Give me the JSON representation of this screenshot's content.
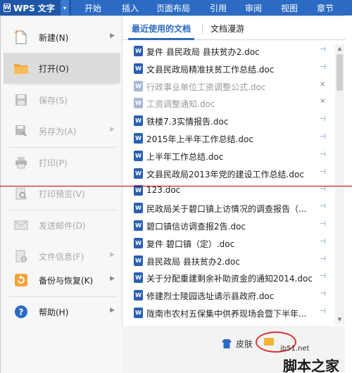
{
  "topbar": {
    "app_button": "WPS 文字",
    "tabs": [
      "开始",
      "插入",
      "页面布局",
      "引用",
      "审阅",
      "视图",
      "章节"
    ]
  },
  "menu": {
    "items": [
      {
        "label": "新建(N)",
        "icon": "new-document-icon",
        "enabled": true,
        "submenu": true
      },
      {
        "label": "打开(O)",
        "icon": "open-folder-icon",
        "enabled": true,
        "submenu": false,
        "selected": true
      },
      {
        "label": "保存(S)",
        "icon": "save-icon",
        "enabled": false,
        "submenu": false
      },
      {
        "label": "另存为(A)",
        "icon": "save-as-icon",
        "enabled": false,
        "submenu": true
      },
      {
        "label": "打印(P)",
        "icon": "printer-icon",
        "enabled": false,
        "submenu": false
      },
      {
        "label": "打印预览(V)",
        "icon": "print-preview-icon",
        "enabled": false,
        "submenu": false
      },
      {
        "label": "发送邮件(D)",
        "icon": "mail-icon",
        "enabled": false,
        "submenu": false
      },
      {
        "label": "文件信息(F)",
        "icon": "info-icon",
        "enabled": false,
        "submenu": true
      },
      {
        "label": "备份与恢复(K)",
        "icon": "backup-icon",
        "enabled": true,
        "submenu": true
      },
      {
        "label": "帮助(H)",
        "icon": "help-icon",
        "enabled": true,
        "submenu": true
      }
    ]
  },
  "recent": {
    "tabs": [
      "最近使用的文档",
      "文档漫游"
    ],
    "files": [
      {
        "name": "复件 县民政局  县扶贫办2.doc",
        "dimmed": false
      },
      {
        "name": "文县民政局精准扶贫工作总结.doc",
        "dimmed": false
      },
      {
        "name": "行政事业单位工资调整公式.doc",
        "dimmed": true
      },
      {
        "name": "工资调整通知.doc",
        "dimmed": true
      },
      {
        "name": "铁楼7.3实情报告.doc",
        "dimmed": false
      },
      {
        "name": "2015年上半年工作总结.doc",
        "dimmed": false
      },
      {
        "name": "上半年工作总结.doc",
        "dimmed": false
      },
      {
        "name": "文县民政局2013年党的建设工作总结.doc",
        "dimmed": false
      },
      {
        "name": "123.doc",
        "dimmed": false
      },
      {
        "name": "民政局关于碧口镇上访情况的调查报告（...",
        "dimmed": false
      },
      {
        "name": "碧口镇信访调查报2告.doc",
        "dimmed": false
      },
      {
        "name": "复件 碧口镇（定）.doc",
        "dimmed": false
      },
      {
        "name": "县民政局  县扶贫办2.doc",
        "dimmed": false
      },
      {
        "name": "关于分配重建剩余补助资金的通知2014.doc",
        "dimmed": false
      },
      {
        "name": "修建烈士陵园选址请示县政府.doc",
        "dimmed": false
      },
      {
        "name": "陇南市农村五保集中供养现场会暨下半年...",
        "dimmed": false
      }
    ]
  },
  "bottom": {
    "skin_label": "皮肤"
  },
  "watermark": {
    "line1": "jb51.net",
    "line2": "脚本之家"
  },
  "colors": {
    "accent": "#2b6bc3",
    "annotation_red": "#d6342c"
  }
}
